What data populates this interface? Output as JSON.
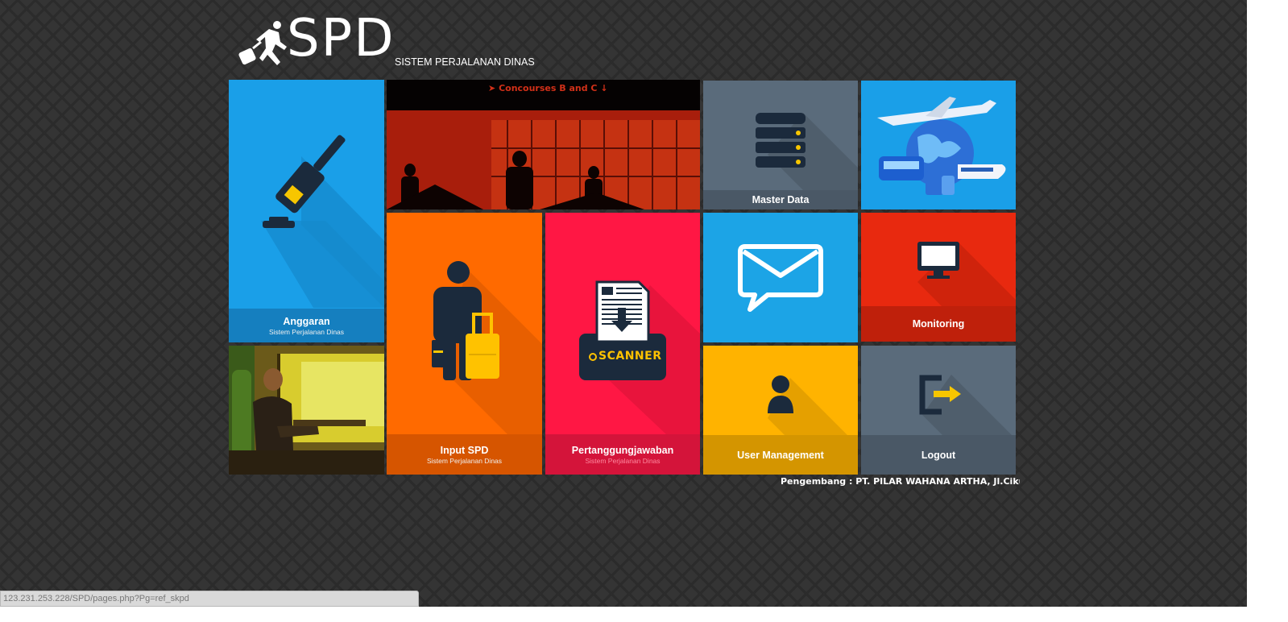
{
  "logo": {
    "text": "SPD",
    "subtitle": "SISTEM PERJALANAN DINAS"
  },
  "tiles": {
    "anggaran": {
      "title": "Anggaran",
      "subtitle": "Sistem Perjalanan Dinas",
      "color": "#1a9fe8",
      "band": "#157fbf"
    },
    "airport": {
      "sign": "Concourses B and C",
      "color": "#b4250f"
    },
    "master_data": {
      "title": "Master Data",
      "color": "#5a6b7b",
      "band": "#4a5866"
    },
    "transport": {
      "color": "#1a9fe8"
    },
    "input_spd": {
      "title": "Input SPD",
      "subtitle": "Sistem Perjalanan Dinas",
      "color": "#ff6a00",
      "band": "#d65500"
    },
    "pertanggungjawaban": {
      "title": "Pertanggungjawaban",
      "subtitle": "Sistem Perjalanan Dinas",
      "scanner_label": "SCANNER",
      "color": "#ff1744",
      "band": "#d4143a"
    },
    "message": {
      "color": "#1ca4e6"
    },
    "monitoring": {
      "title": "Monitoring",
      "color": "#e8290f",
      "band": "#bf200b"
    },
    "train_photo": {
      "color": "#c8b42a"
    },
    "user_management": {
      "title": "User Management",
      "color": "#ffb300",
      "band": "#d49500"
    },
    "logout": {
      "title": "Logout",
      "color": "#5a6b7b",
      "band": "#4a5866"
    }
  },
  "footer": {
    "text": "Pengembang : PT. PILAR WAHANA ARTHA, Jl.Cikutra B"
  },
  "status_bar": {
    "url": "123.231.253.228/SPD/pages.php?Pg=ref_skpd"
  }
}
